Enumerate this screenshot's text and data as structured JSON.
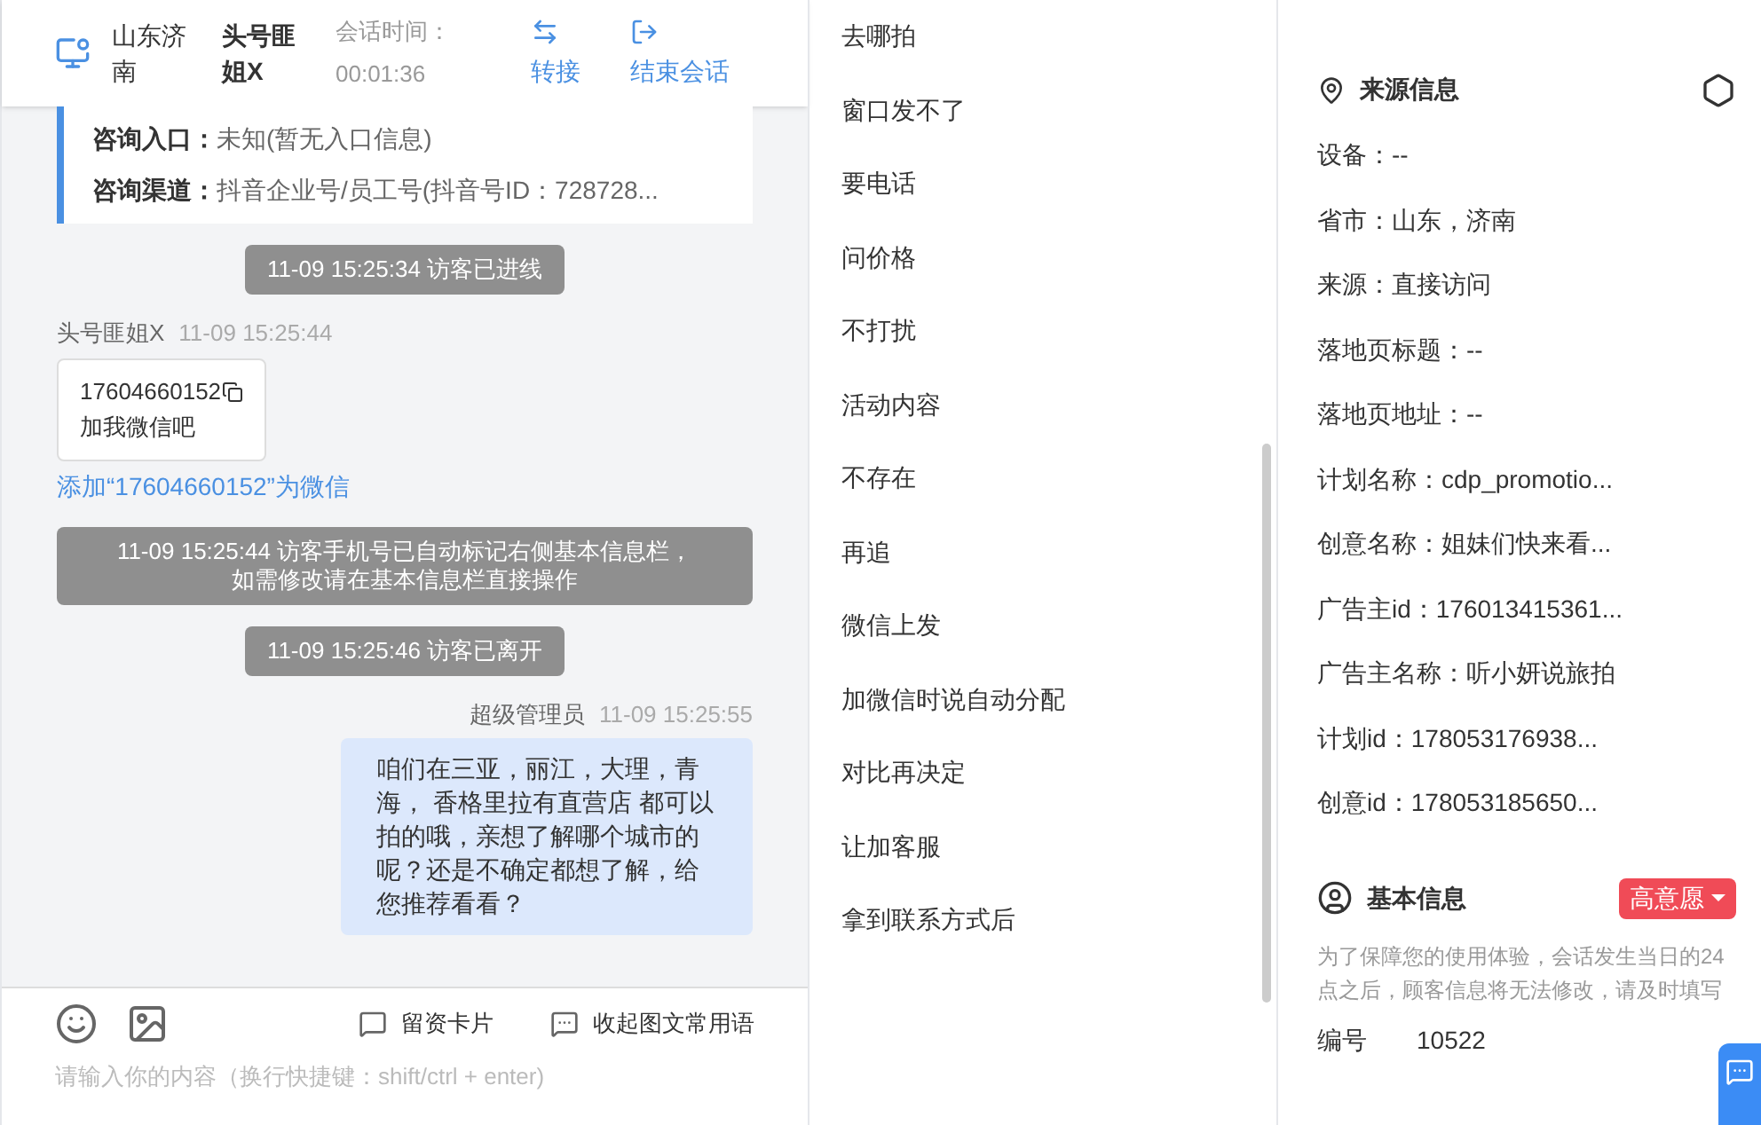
{
  "header": {
    "location": "山东济南",
    "visitor": "头号匪姐X",
    "session_label": "会话时间：",
    "session_time": "00:01:36",
    "actions": [
      {
        "kind": "transfer",
        "label": "转接"
      },
      {
        "kind": "end",
        "label": "结束会话"
      }
    ]
  },
  "info_card": [
    {
      "label": "咨询入口：",
      "value": "未知(暂无入口信息)"
    },
    {
      "label": "咨询渠道：",
      "value": "抖音企业号/员工号(抖音号ID：728728..."
    }
  ],
  "messages": [
    {
      "kind": "system",
      "text": "11-09 15:25:34 访客已进线"
    },
    {
      "kind": "visitor",
      "sender": "头号匪姐X",
      "time": "11-09 15:25:44",
      "phone": "17604660152",
      "text": "加我微信吧",
      "link": "添加“17604660152”为微信"
    },
    {
      "kind": "system_multi",
      "lines": [
        "11-09 15:25:44 访客手机号已自动标记右侧基本信息栏，",
        "如需修改请在基本信息栏直接操作"
      ]
    },
    {
      "kind": "system",
      "text": "11-09 15:25:46 访客已离开"
    },
    {
      "kind": "agent",
      "sender": "超级管理员",
      "time": "11-09 15:25:55",
      "text": "咱们在三亚，丽江，大理，青海， 香格里拉有直营店 都可以拍的哦，亲想了解哪个城市的呢？还是不确定都想了解，给您推荐看看？"
    }
  ],
  "composer": {
    "tools": [
      {
        "kind": "card",
        "label": "留资卡片"
      },
      {
        "kind": "phrases",
        "label": "收起图文常用语"
      }
    ],
    "placeholder": "请输入你的内容（换行快捷键：shift/ctrl + enter)"
  },
  "quick_replies": [
    "去哪拍",
    "窗口发不了",
    "要电话",
    "问价格",
    "不打扰",
    "活动内容",
    "不存在",
    "再追",
    "微信上发",
    "加微信时说自动分配",
    "对比再决定",
    "让加客服",
    "拿到联系方式后"
  ],
  "source_info": {
    "title": "来源信息",
    "fields": [
      "设备：--",
      "省市：山东，济南",
      "来源：直接访问",
      "落地页标题：--",
      "落地页地址：--",
      "计划名称：cdp_promotio...",
      "创意名称：姐妹们快来看...",
      "广告主id：176013415361...",
      "广告主名称：听小妍说旅拍",
      "计划id：178053176938...",
      "创意id：178053185650..."
    ]
  },
  "basic_info": {
    "title": "基本信息",
    "intent_tag": "高意愿",
    "note": "为了保障您的使用体验，会话发生当日的24点之后，顾客信息将无法修改，请及时填写",
    "fields": [
      {
        "label": "编号",
        "value": "10522"
      }
    ]
  }
}
